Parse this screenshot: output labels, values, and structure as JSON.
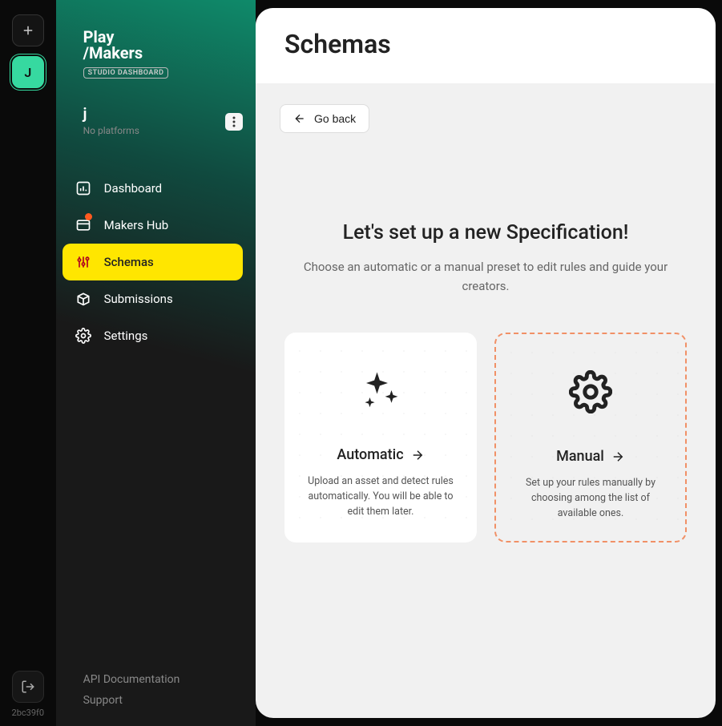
{
  "rail": {
    "workspace_letter": "J",
    "hash": "2bc39f0"
  },
  "logo": {
    "line1": "Play",
    "line2": "/Makers",
    "badge": "STUDIO DASHBOARD"
  },
  "workspace": {
    "name": "j",
    "subtitle": "No platforms"
  },
  "nav": {
    "dashboard": "Dashboard",
    "makers_hub": "Makers Hub",
    "schemas": "Schemas",
    "submissions": "Submissions",
    "settings": "Settings"
  },
  "footer": {
    "api_docs": "API Documentation",
    "support": "Support"
  },
  "page": {
    "title": "Schemas",
    "go_back": "Go back"
  },
  "spec": {
    "heading": "Let's set up a new Specification!",
    "sub": "Choose an automatic or a manual preset to edit rules and guide your creators."
  },
  "cards": {
    "automatic": {
      "title": "Automatic",
      "desc": "Upload an asset and detect rules automatically. You will be able to edit them later."
    },
    "manual": {
      "title": "Manual",
      "desc": "Set up your rules manually by choosing among the list of available ones."
    }
  }
}
